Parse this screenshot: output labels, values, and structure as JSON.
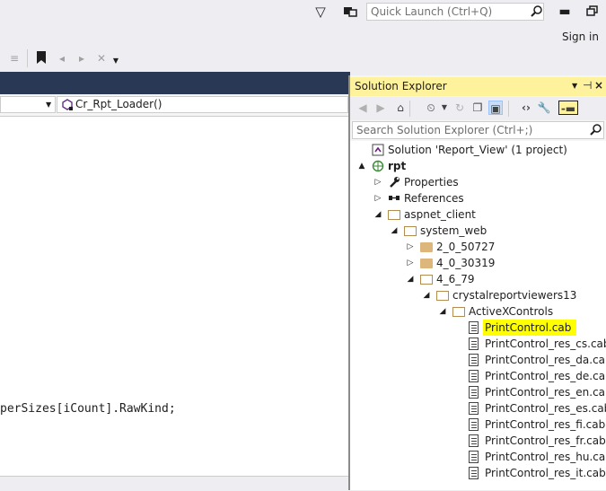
{
  "titlebar": {
    "quick_launch_placeholder": "Quick Launch (Ctrl+Q)",
    "sign_in": "Sign in"
  },
  "nav": {
    "member_dropdown": "Cr_Rpt_Loader()"
  },
  "editor": {
    "code_line": "perSizes[iCount].RawKind;"
  },
  "solution_explorer": {
    "title": "Solution Explorer",
    "pin_glyph": "⊣",
    "search_placeholder": "Search Solution Explorer (Ctrl+;)",
    "tree": [
      {
        "label": "Solution 'Report_View' (1 project)",
        "icon": "solution-icon",
        "expander": ""
      },
      {
        "label": "rpt",
        "icon": "web-project-icon",
        "expander": "▲"
      },
      {
        "label": "Properties",
        "icon": "wrench-icon",
        "expander": "▷"
      },
      {
        "label": "References",
        "icon": "references-icon",
        "expander": "▷"
      },
      {
        "label": "aspnet_client",
        "icon": "folder-open-icon",
        "expander": "◢"
      },
      {
        "label": "system_web",
        "icon": "folder-open-icon",
        "expander": "◢"
      },
      {
        "label": "2_0_50727",
        "icon": "folder-icon",
        "expander": "▷"
      },
      {
        "label": "4_0_30319",
        "icon": "folder-icon",
        "expander": "▷"
      },
      {
        "label": "4_6_79",
        "icon": "folder-open-icon",
        "expander": "◢"
      },
      {
        "label": "crystalreportviewers13",
        "icon": "folder-open-icon",
        "expander": "◢"
      },
      {
        "label": "ActiveXControls",
        "icon": "folder-open-icon",
        "expander": "◢"
      },
      {
        "label": "PrintControl.cab",
        "icon": "cab-file-icon",
        "expander": "",
        "selected": true
      },
      {
        "label": "PrintControl_res_cs.cab",
        "icon": "cab-file-icon",
        "expander": ""
      },
      {
        "label": "PrintControl_res_da.cab",
        "icon": "cab-file-icon",
        "expander": ""
      },
      {
        "label": "PrintControl_res_de.cab",
        "icon": "cab-file-icon",
        "expander": ""
      },
      {
        "label": "PrintControl_res_en.cab",
        "icon": "cab-file-icon",
        "expander": ""
      },
      {
        "label": "PrintControl_res_es.cab",
        "icon": "cab-file-icon",
        "expander": ""
      },
      {
        "label": "PrintControl_res_fi.cab",
        "icon": "cab-file-icon",
        "expander": ""
      },
      {
        "label": "PrintControl_res_fr.cab",
        "icon": "cab-file-icon",
        "expander": ""
      },
      {
        "label": "PrintControl_res_hu.cab",
        "icon": "cab-file-icon",
        "expander": ""
      },
      {
        "label": "PrintControl_res_it.cab",
        "icon": "cab-file-icon",
        "expander": ""
      }
    ]
  },
  "colors": {
    "highlight": "#ffff00",
    "panel_title_active": "#fff29d",
    "dark_strip": "#293955"
  }
}
